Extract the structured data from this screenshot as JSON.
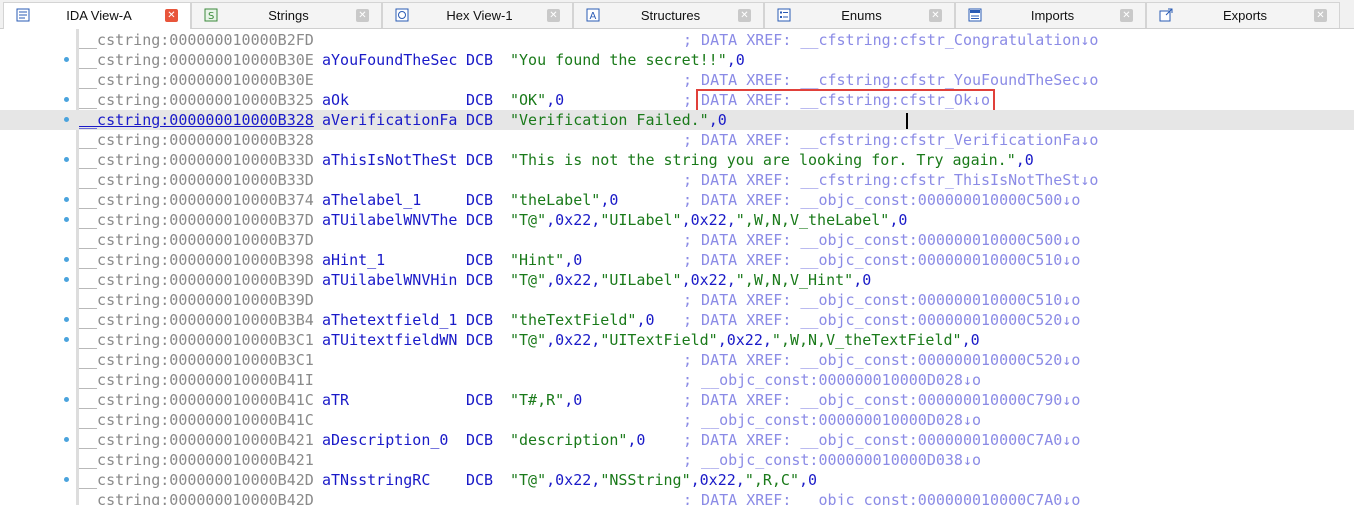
{
  "tabs": [
    {
      "label": "IDA View-A",
      "icon": "ida-view-icon",
      "active": true
    },
    {
      "label": "Strings",
      "icon": "strings-icon",
      "active": false
    },
    {
      "label": "Hex View-1",
      "icon": "hex-view-icon",
      "active": false
    },
    {
      "label": "Structures",
      "icon": "structures-icon",
      "active": false
    },
    {
      "label": "Enums",
      "icon": "enums-icon",
      "active": false
    },
    {
      "label": "Imports",
      "icon": "imports-icon",
      "active": false
    },
    {
      "label": "Exports",
      "icon": "exports-icon",
      "active": false
    }
  ],
  "close_glyph": "✕",
  "lines": [
    {
      "addr": "__cstring:000000010000B2FD",
      "name": "",
      "op": "",
      "operand": "",
      "comment": "; DATA XREF: __cfstring:cfstr_Congratulation↓o"
    },
    {
      "addr": "__cstring:000000010000B30E",
      "name": "aYouFoundTheSec",
      "op": "DCB",
      "operand": "\"You found the secret!!\",0",
      "comment": ""
    },
    {
      "addr": "__cstring:000000010000B30E",
      "name": "",
      "op": "",
      "operand": "",
      "comment": "; DATA XREF: __cfstring:cfstr_YouFoundTheSec↓o"
    },
    {
      "addr": "__cstring:000000010000B325",
      "name": "aOk",
      "op": "DCB",
      "operand": "\"OK\",0",
      "comment": "; DATA XREF: __cfstring:cfstr_Ok↓o"
    },
    {
      "addr": "__cstring:000000010000B328",
      "name": "aVerificationFa",
      "op": "DCB",
      "operand": "\"Verification Failed.\",0",
      "comment": ""
    },
    {
      "addr": "__cstring:000000010000B328",
      "name": "",
      "op": "",
      "operand": "",
      "comment": "; DATA XREF: __cfstring:cfstr_VerificationFa↓o"
    },
    {
      "addr": "__cstring:000000010000B33D",
      "name": "aThisIsNotTheSt",
      "op": "DCB",
      "operand": "\"This is not the string you are looking for. Try again.\",0",
      "comment": ""
    },
    {
      "addr": "__cstring:000000010000B33D",
      "name": "",
      "op": "",
      "operand": "",
      "comment": "; DATA XREF: __cfstring:cfstr_ThisIsNotTheSt↓o"
    },
    {
      "addr": "__cstring:000000010000B374",
      "name": "aThelabel_1",
      "op": "DCB",
      "operand": "\"theLabel\",0",
      "comment": "; DATA XREF: __objc_const:000000010000C500↓o"
    },
    {
      "addr": "__cstring:000000010000B37D",
      "name": "aTUilabelWNVThe",
      "op": "DCB",
      "operand": "\"T@\",0x22,\"UILabel\",0x22,\",W,N,V_theLabel\",0",
      "comment": ""
    },
    {
      "addr": "__cstring:000000010000B37D",
      "name": "",
      "op": "",
      "operand": "",
      "comment": "; DATA XREF: __objc_const:000000010000C500↓o"
    },
    {
      "addr": "__cstring:000000010000B398",
      "name": "aHint_1",
      "op": "DCB",
      "operand": "\"Hint\",0",
      "comment": "; DATA XREF: __objc_const:000000010000C510↓o"
    },
    {
      "addr": "__cstring:000000010000B39D",
      "name": "aTUilabelWNVHin",
      "op": "DCB",
      "operand": "\"T@\",0x22,\"UILabel\",0x22,\",W,N,V_Hint\",0",
      "comment": ""
    },
    {
      "addr": "__cstring:000000010000B39D",
      "name": "",
      "op": "",
      "operand": "",
      "comment": "; DATA XREF: __objc_const:000000010000C510↓o"
    },
    {
      "addr": "__cstring:000000010000B3B4",
      "name": "aThetextfield_1",
      "op": "DCB",
      "operand": "\"theTextField\",0",
      "comment": "; DATA XREF: __objc_const:000000010000C520↓o"
    },
    {
      "addr": "__cstring:000000010000B3C1",
      "name": "aTUitextfieldWN",
      "op": "DCB",
      "operand": "\"T@\",0x22,\"UITextField\",0x22,\",W,N,V_theTextField\",0",
      "comment": ""
    },
    {
      "addr": "__cstring:000000010000B3C1",
      "name": "",
      "op": "",
      "operand": "",
      "comment": "; DATA XREF: __objc_const:000000010000C520↓o"
    },
    {
      "addr": "__cstring:000000010000B41I",
      "name": "",
      "op": "",
      "operand": "",
      "comment": "; __objc_const:000000010000D028↓o"
    },
    {
      "addr": "__cstring:000000010000B41C",
      "name": "aTR",
      "op": "DCB",
      "operand": "\"T#,R\",0",
      "comment": "; DATA XREF: __objc_const:000000010000C790↓o"
    },
    {
      "addr": "__cstring:000000010000B41C",
      "name": "",
      "op": "",
      "operand": "",
      "comment": "; __objc_const:000000010000D028↓o"
    },
    {
      "addr": "__cstring:000000010000B421",
      "name": "aDescription_0",
      "op": "DCB",
      "operand": "\"description\",0",
      "comment": "; DATA XREF: __objc_const:000000010000C7A0↓o"
    },
    {
      "addr": "__cstring:000000010000B421",
      "name": "",
      "op": "",
      "operand": "",
      "comment": "; __objc_const:000000010000D038↓o"
    },
    {
      "addr": "__cstring:000000010000B42D",
      "name": "aTNsstringRC",
      "op": "DCB",
      "operand": "\"T@\",0x22,\"NSString\",0x22,\",R,C\",0",
      "comment": ""
    },
    {
      "addr": "__cstring:000000010000B42D",
      "name": "",
      "op": "",
      "operand": "",
      "comment": "; DATA XREF: __objc_const:000000010000C7A0↓o"
    }
  ],
  "current_line_index": 4,
  "highlighted_line_index": 3,
  "colors": {
    "address": "#8a8a8a",
    "name": "#1a1ac8",
    "string": "#1a7a1a",
    "comment": "#8b8be6",
    "highlight_box": "#e0403a",
    "active_close": "#e8553b"
  }
}
